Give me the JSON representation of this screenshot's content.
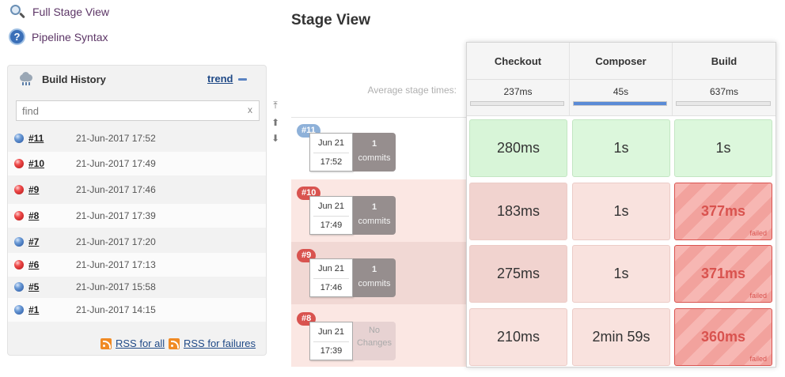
{
  "links": {
    "full_stage_view": "Full Stage View",
    "pipeline_syntax": "Pipeline Syntax"
  },
  "build_history": {
    "title": "Build History",
    "trend": "trend",
    "find_placeholder": "find",
    "clear": "x",
    "rows": [
      {
        "number": "#11",
        "date": "21-Jun-2017 17:52",
        "status": "blue"
      },
      {
        "number": "#10",
        "date": "21-Jun-2017 17:49",
        "status": "red"
      },
      {
        "number": "#9",
        "date": "21-Jun-2017 17:46",
        "status": "red"
      },
      {
        "number": "#8",
        "date": "21-Jun-2017 17:39",
        "status": "red"
      },
      {
        "number": "#7",
        "date": "21-Jun-2017 17:20",
        "status": "blue"
      },
      {
        "number": "#6",
        "date": "21-Jun-2017 17:13",
        "status": "red"
      },
      {
        "number": "#5",
        "date": "21-Jun-2017 15:58",
        "status": "blue"
      },
      {
        "number": "#1",
        "date": "21-Jun-2017 14:15",
        "status": "blue"
      }
    ],
    "rss_all": "RSS for all",
    "rss_failures": "RSS for failures"
  },
  "stage_view": {
    "title": "Stage View",
    "avg_label": "Average stage times:",
    "stages": [
      {
        "name": "Checkout",
        "avg": "237ms",
        "avg_fraction": 0.0
      },
      {
        "name": "Composer",
        "avg": "45s",
        "avg_fraction": 1.0
      },
      {
        "name": "Build",
        "avg": "637ms",
        "avg_fraction": 0.0
      }
    ],
    "builds": [
      {
        "badge": "#11",
        "date": "Jun 21",
        "time": "17:52",
        "commits_count": "1",
        "commits_label": "commits",
        "result": "success",
        "cells": [
          {
            "value": "280ms",
            "status": "success"
          },
          {
            "value": "1s",
            "status": "success"
          },
          {
            "value": "1s",
            "status": "success"
          }
        ]
      },
      {
        "badge": "#10",
        "date": "Jun 21",
        "time": "17:49",
        "commits_count": "1",
        "commits_label": "commits",
        "result": "failed",
        "cells": [
          {
            "value": "183ms",
            "status": "unstable"
          },
          {
            "value": "1s",
            "status": "unstable"
          },
          {
            "value": "377ms",
            "status": "failed",
            "tag": "failed"
          }
        ]
      },
      {
        "badge": "#9",
        "date": "Jun 21",
        "time": "17:46",
        "commits_count": "1",
        "commits_label": "commits",
        "result": "failed",
        "cells": [
          {
            "value": "275ms",
            "status": "unstable"
          },
          {
            "value": "1s",
            "status": "unstable"
          },
          {
            "value": "371ms",
            "status": "failed",
            "tag": "failed"
          }
        ]
      },
      {
        "badge": "#8",
        "date": "Jun 21",
        "time": "17:39",
        "commits_count": "No",
        "commits_label": "Changes",
        "result": "failed",
        "cells": [
          {
            "value": "210ms",
            "status": "unstable"
          },
          {
            "value": "2min 59s",
            "status": "unstable"
          },
          {
            "value": "360ms",
            "status": "failed",
            "tag": "failed"
          }
        ]
      }
    ]
  },
  "colors": {
    "success_bg": "#dcf7dc",
    "unstable_bg": "#f9e2de",
    "failed_border": "#d9534f",
    "link": "#204a87"
  },
  "icons": {
    "full_stage_view": "search-icon",
    "pipeline_syntax": "help-icon",
    "build_history": "cloud-icon",
    "rss": "rss-icon"
  }
}
